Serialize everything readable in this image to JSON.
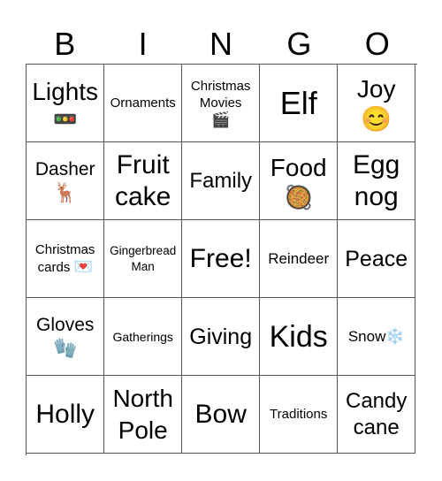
{
  "header": {
    "letters": [
      "B",
      "I",
      "N",
      "G",
      "O"
    ]
  },
  "cells": [
    {
      "label": "Lights",
      "icon": "🚥",
      "icon_name": "traffic-light-icon"
    },
    {
      "label": "Ornaments"
    },
    {
      "label": "Christmas Movies",
      "icon": "🎬",
      "icon_name": "clapper-board-icon"
    },
    {
      "label": "Elf"
    },
    {
      "label": "Joy",
      "icon": "😊",
      "icon_name": "smiling-face-icon"
    },
    {
      "label": "Dasher",
      "icon": "🦌",
      "icon_name": "deer-icon"
    },
    {
      "label": "Fruit cake"
    },
    {
      "label": "Family"
    },
    {
      "label": "Food",
      "icon": "🥘",
      "icon_name": "paella-pan-icon"
    },
    {
      "label": "Egg nog"
    },
    {
      "label": "Christmas cards",
      "icon": "💌",
      "icon_name": "love-letter-icon"
    },
    {
      "label": "Gingerbread Man"
    },
    {
      "label": "Free!"
    },
    {
      "label": "Reindeer"
    },
    {
      "label": "Peace"
    },
    {
      "label": "Gloves",
      "icon": "🧤",
      "icon_name": "gloves-icon"
    },
    {
      "label": "Gatherings"
    },
    {
      "label": "Giving"
    },
    {
      "label": "Kids"
    },
    {
      "label": "Snow",
      "icon": "❄️",
      "icon_name": "snowflake-icon"
    },
    {
      "label": "Holly"
    },
    {
      "label": "North Pole"
    },
    {
      "label": "Bow"
    },
    {
      "label": "Traditions"
    },
    {
      "label": "Candy cane"
    }
  ]
}
